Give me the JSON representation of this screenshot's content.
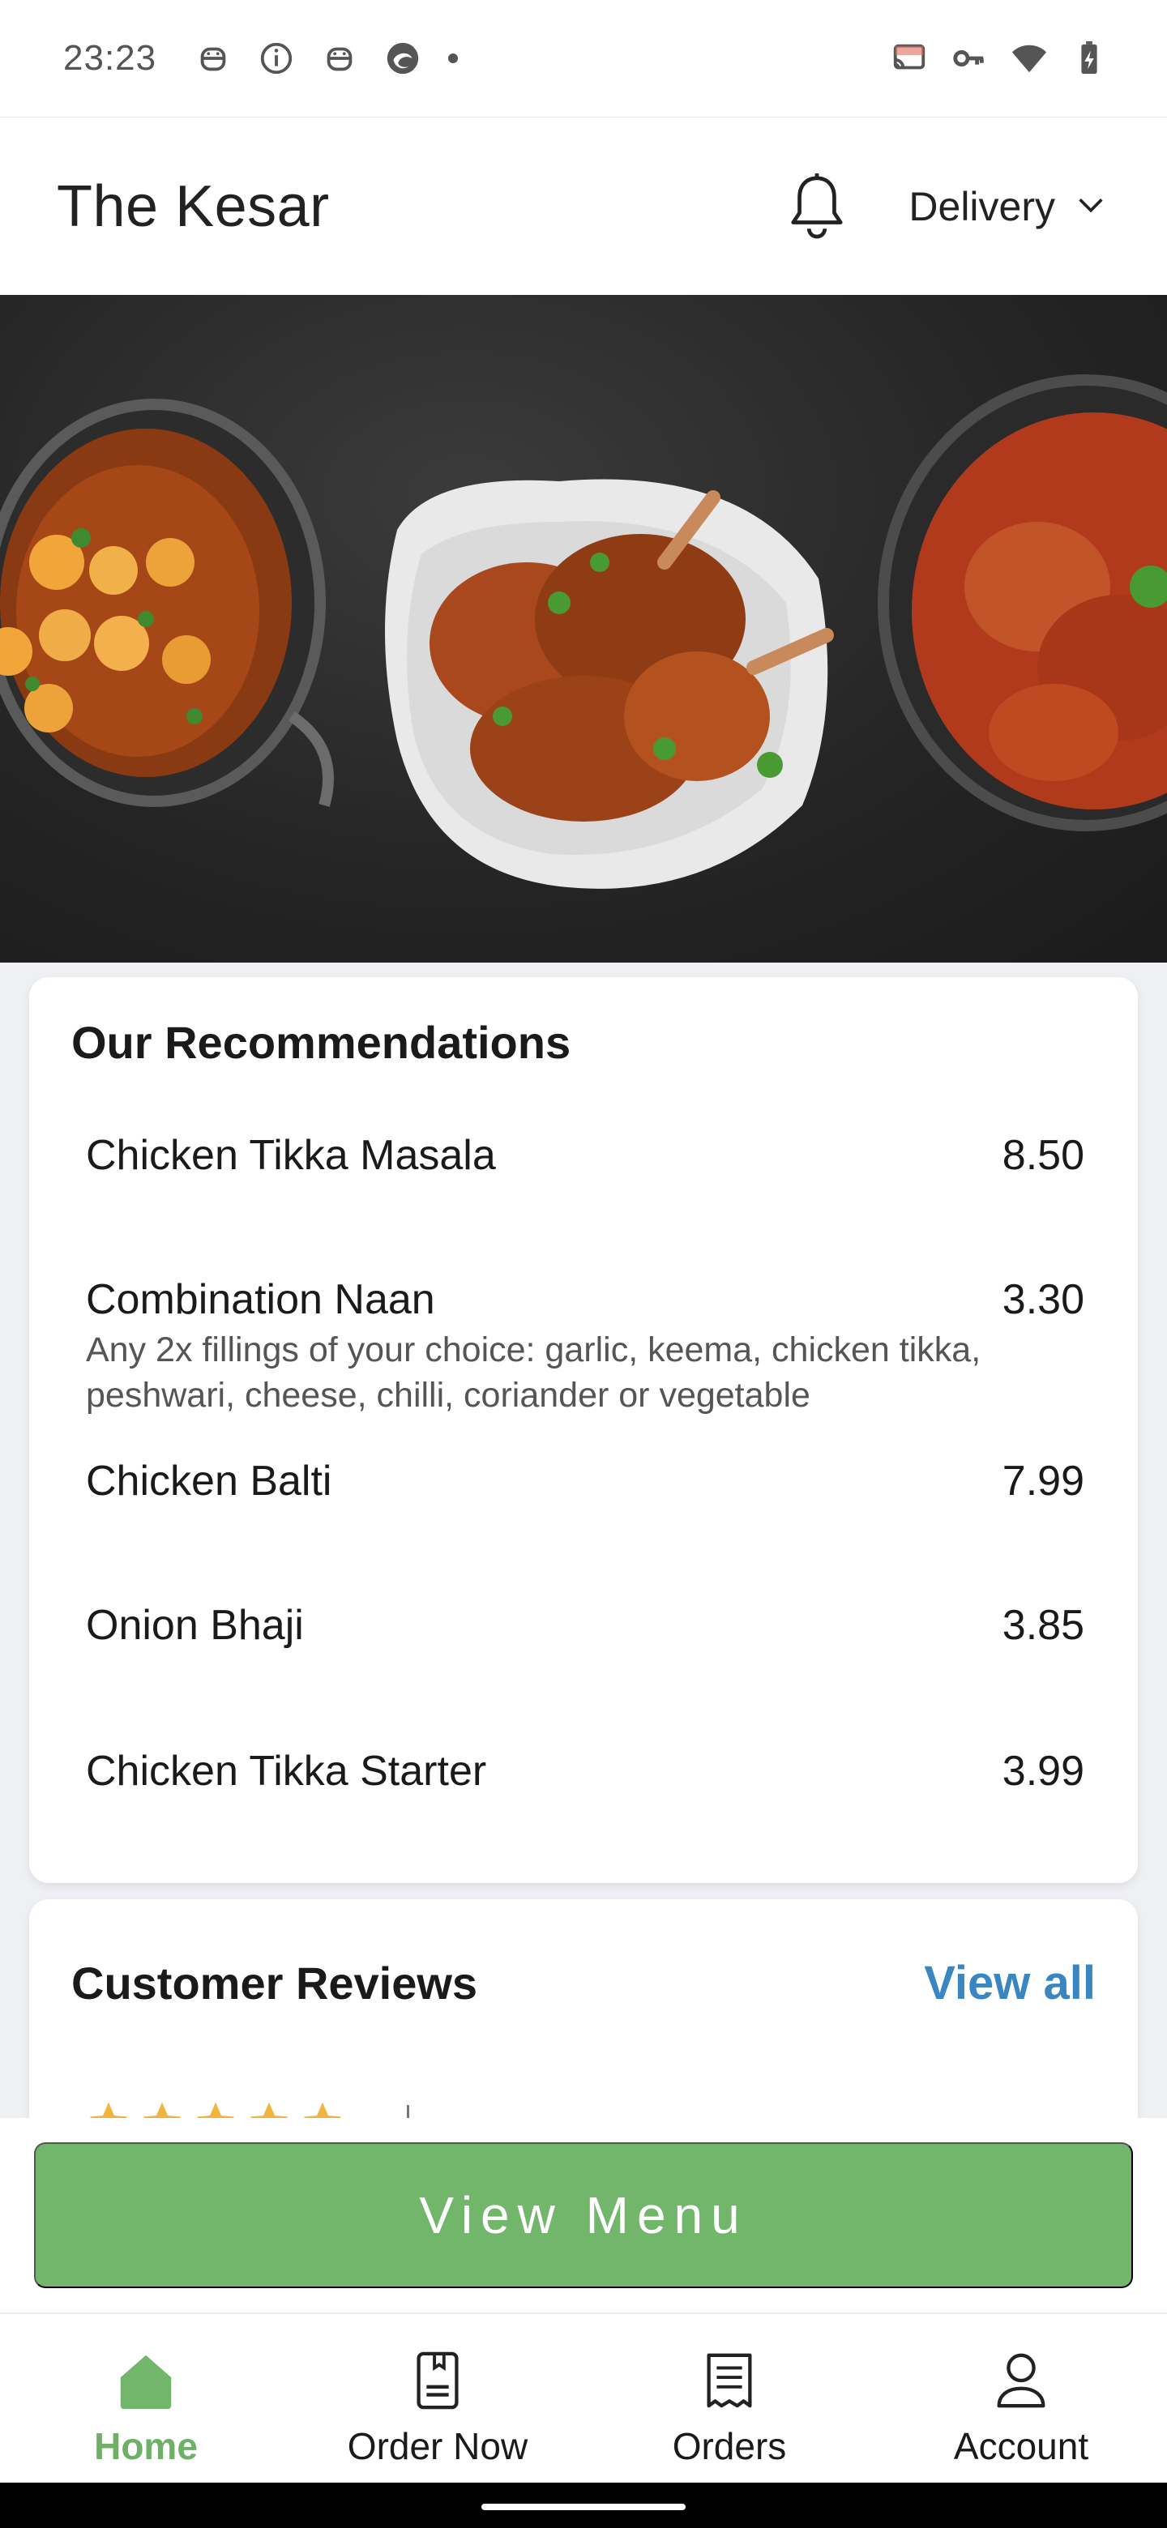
{
  "status_bar": {
    "time": "23:23",
    "left_icons": [
      "robot-notification-icon",
      "info-icon",
      "robot-notification-icon",
      "browser-icon",
      "more-dot-icon"
    ],
    "right_icons": [
      "cast-icon",
      "vpn-key-icon",
      "wifi-icon",
      "battery-charging-icon"
    ]
  },
  "header": {
    "title": "The Kesar",
    "delivery_label": "Delivery"
  },
  "recommendations": {
    "heading": "Our Recommendations",
    "items": [
      {
        "name": "Chicken Tikka Masala",
        "price": "8.50",
        "description": ""
      },
      {
        "name": "Combination Naan",
        "price": "3.30",
        "description": "Any 2x fillings of your choice: garlic, keema, chicken tikka, peshwari,  cheese, chilli, coriander or vegetable"
      },
      {
        "name": "Chicken Balti",
        "price": "7.99",
        "description": ""
      },
      {
        "name": "Onion Bhaji",
        "price": "3.85",
        "description": ""
      },
      {
        "name": "Chicken Tikka Starter",
        "price": "3.99",
        "description": ""
      }
    ]
  },
  "reviews": {
    "heading": "Customer Reviews",
    "view_all": "View all",
    "rating": 5
  },
  "view_menu_label": "View Menu",
  "nav": {
    "items": [
      {
        "label": "Home",
        "icon": "home-icon",
        "active": true
      },
      {
        "label": "Order Now",
        "icon": "order-book-icon",
        "active": false
      },
      {
        "label": "Orders",
        "icon": "receipt-icon",
        "active": false
      },
      {
        "label": "Account",
        "icon": "account-icon",
        "active": false
      }
    ]
  },
  "colors": {
    "accent_green": "#72b66c",
    "link_blue": "#3a86c0",
    "star_yellow": "#f3b340"
  }
}
